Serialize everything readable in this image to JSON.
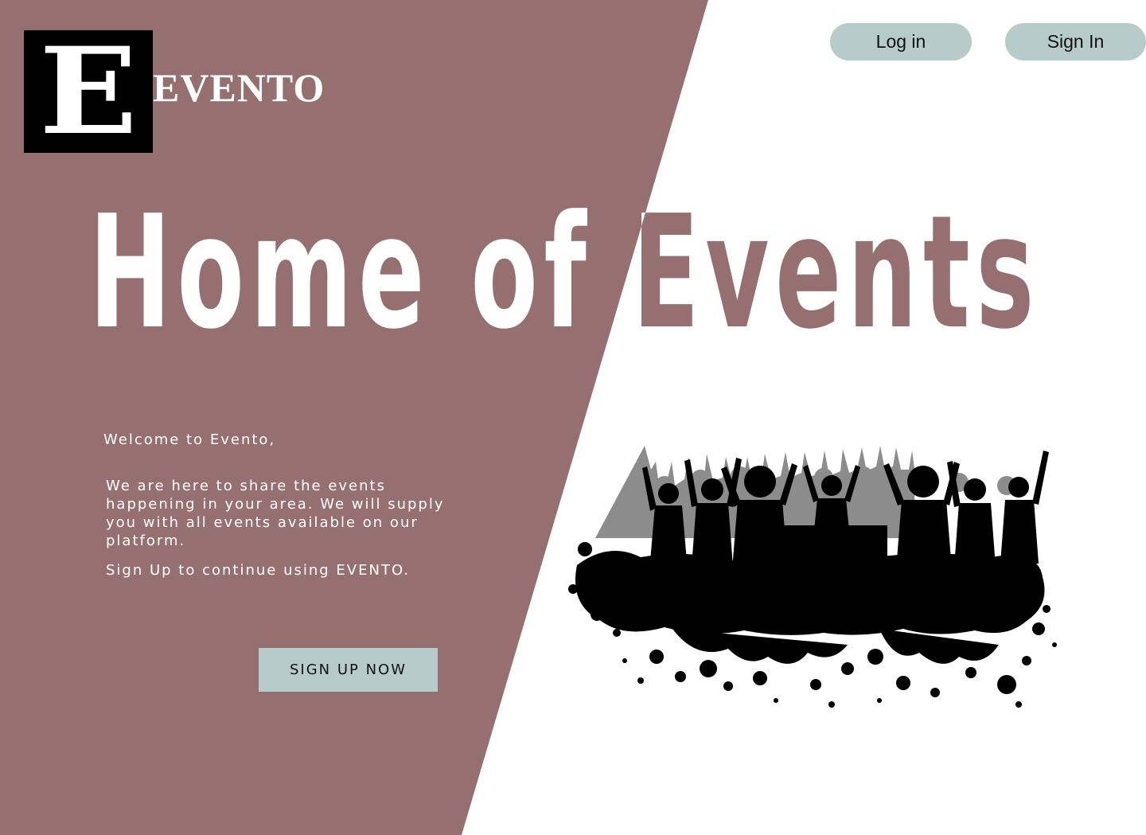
{
  "brand": {
    "logo_letter": "E",
    "name": "EVENTO"
  },
  "nav": {
    "login_label": "Log in",
    "signin_label": "Sign In"
  },
  "hero": {
    "title_left": "Home of ",
    "title_right": "Events"
  },
  "intro": {
    "welcome": "Welcome to Evento,",
    "body": "We are here to share the events happening in your area. We will supply you with all events available on our platform.",
    "cta_text": "Sign Up to continue using EVENTO."
  },
  "cta": {
    "button_label": "SIGN UP NOW"
  },
  "illustration": {
    "icon": "party-crowd-silhouette"
  },
  "colors": {
    "panel": "#967070",
    "button": "#b7cbca",
    "text_light": "#ffffff",
    "logo_bg": "#000000"
  }
}
